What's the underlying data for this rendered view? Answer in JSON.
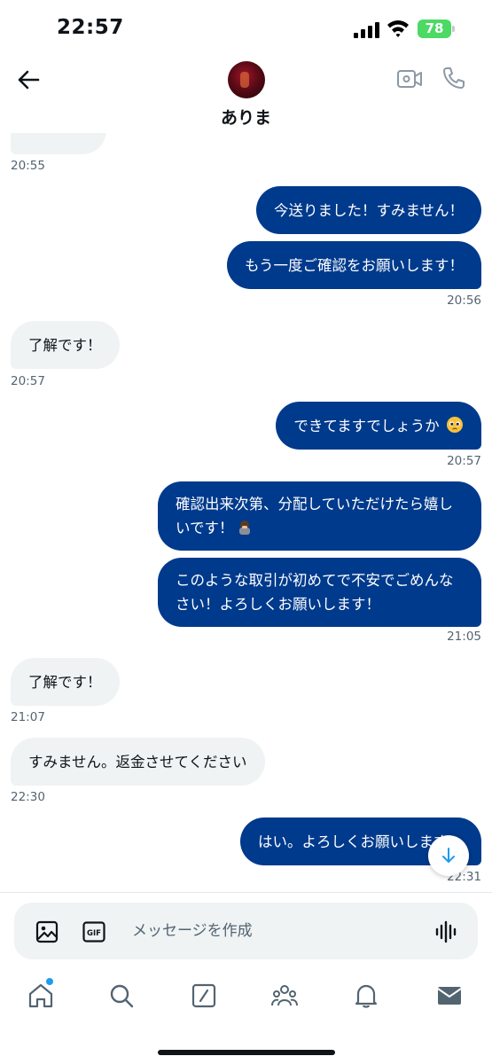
{
  "status_bar": {
    "time": "22:57",
    "battery": "78"
  },
  "header": {
    "contact_name": "ありま"
  },
  "messages": [
    {
      "id": "m0",
      "side": "in",
      "text": "",
      "time": "20:55"
    },
    {
      "id": "m1",
      "side": "out",
      "text": "今送りました！すみません！",
      "time": ""
    },
    {
      "id": "m2",
      "side": "out",
      "text": "もう一度ご確認をお願いします！",
      "time": "20:56"
    },
    {
      "id": "m3",
      "side": "in",
      "text": "了解です！",
      "time": "20:57"
    },
    {
      "id": "m4",
      "side": "out",
      "text": "できてますでしょうか",
      "emoji": "pleading-face",
      "time": "20:57"
    },
    {
      "id": "m5",
      "side": "out",
      "line1": "確認出来次第、分配していただけたら嬉し",
      "line2": "いです！",
      "emoji": "bowing-person",
      "time": ""
    },
    {
      "id": "m6",
      "side": "out",
      "line1": "このような取引が初めてで不安でごめんな",
      "line2": "さい！よろしくお願いします！",
      "time": "21:05"
    },
    {
      "id": "m7",
      "side": "in",
      "text": "了解です！",
      "time": "21:07"
    },
    {
      "id": "m8",
      "side": "in",
      "text": "すみません。返金させてください",
      "time": "22:30"
    },
    {
      "id": "m9",
      "side": "out",
      "text": "はい。よろしくお願いします",
      "time": "22:31"
    }
  ],
  "composer": {
    "placeholder": "メッセージを作成",
    "gif_label": "GIF"
  },
  "icons": [
    "back-arrow-icon",
    "video-call-icon",
    "phone-icon",
    "image-icon",
    "gif-icon",
    "voice-icon",
    "home-icon",
    "search-icon",
    "compose-icon",
    "communities-icon",
    "bell-icon",
    "mail-icon",
    "arrow-down-icon"
  ],
  "colors": {
    "outgoing_bubble": "#003a8c",
    "incoming_bubble": "#eff3f4",
    "notification_dot": "#1d9bf0",
    "battery": "#4cd964"
  }
}
